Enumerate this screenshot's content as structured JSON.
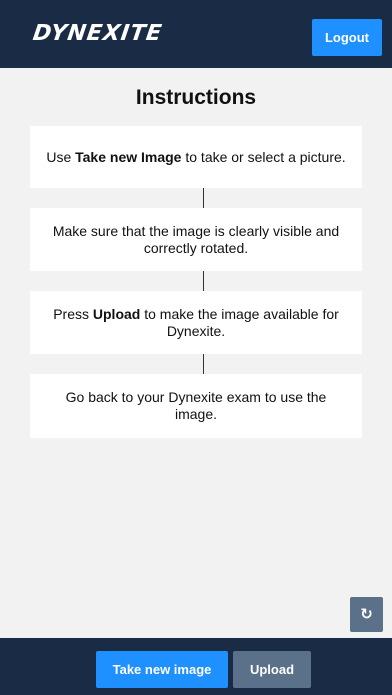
{
  "header": {
    "logo_text": "DYNEXITE",
    "logout_label": "Logout"
  },
  "main": {
    "title": "Instructions",
    "steps": [
      {
        "pre": "Use ",
        "bold": "Take new Image",
        "post": " to take or select a picture."
      },
      {
        "pre": "Make sure that the image is clearly visible and correctly rotated.",
        "bold": "",
        "post": ""
      },
      {
        "pre": "Press ",
        "bold": "Upload",
        "post": " to make the image available for Dynexite."
      },
      {
        "pre": "Go back to your Dynexite exam to use the image.",
        "bold": "",
        "post": ""
      }
    ],
    "rotate_icon": "↻"
  },
  "footer": {
    "take_label": "Take new image",
    "upload_label": "Upload"
  },
  "colors": {
    "header_bg": "#1a2b45",
    "primary": "#1e90ff",
    "secondary": "#5b7189",
    "page_bg": "#f2f2f2"
  },
  "icons": {
    "rotate": "rotate-icon"
  }
}
